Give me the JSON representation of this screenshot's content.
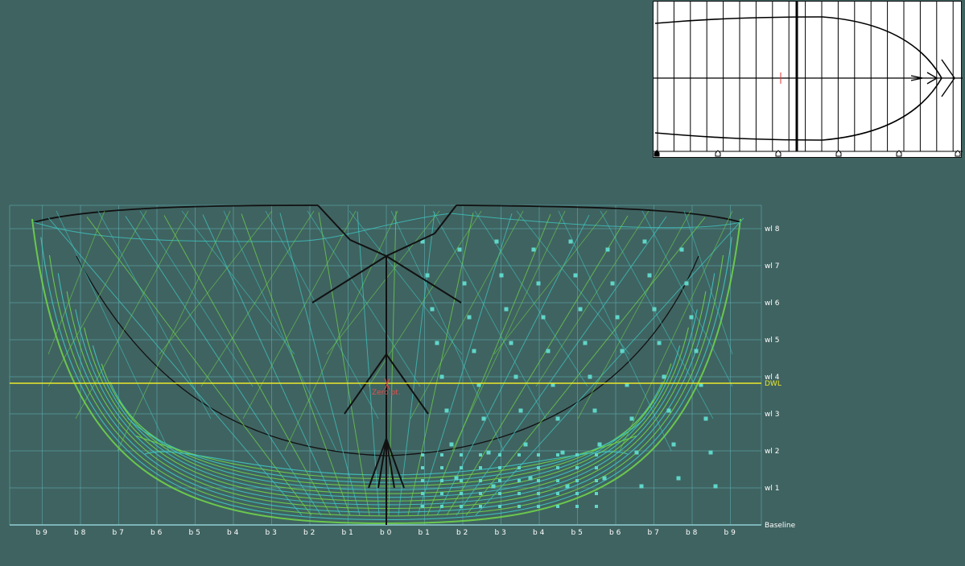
{
  "body_plan": {
    "waterline_labels": [
      "wl 1",
      "wl 2",
      "wl 3",
      "wl 4",
      "wl 5",
      "wl 6",
      "wl 7",
      "wl 8"
    ],
    "dwl_label": "DWL",
    "baseline_label": "Baseline",
    "zero_point_label": "Zero pt.",
    "buttock_labels": [
      "b 9",
      "b 8",
      "b 7",
      "b 6",
      "b 5",
      "b 4",
      "b 3",
      "b 2",
      "b 1",
      "b 0",
      "b 1",
      "b 2",
      "b 3",
      "b 4",
      "b 5",
      "b 6",
      "b 7",
      "b 8",
      "b 9"
    ]
  },
  "colors": {
    "background": "#3f6361",
    "grid": "#5fb0b6",
    "mesh_green": "#6fd24a",
    "mesh_cyan": "#3fc6c0",
    "control_black": "#111111",
    "dwl": "#e8e82a",
    "zero_point": "#e05050"
  }
}
